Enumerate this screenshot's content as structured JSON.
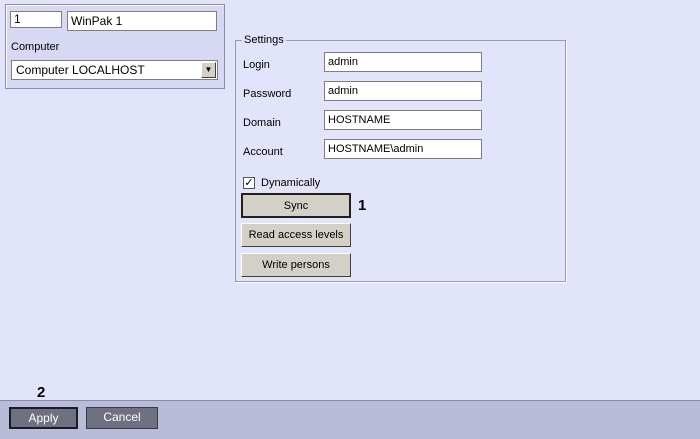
{
  "object": {
    "id": "1",
    "name": "WinPak 1"
  },
  "computer": {
    "label": "Computer",
    "selected": "Computer LOCALHOST"
  },
  "settings": {
    "legend": "Settings",
    "login_label": "Login",
    "login_value": "admin",
    "password_label": "Password",
    "password_value": "admin",
    "domain_label": "Domain",
    "domain_value": "HOSTNAME",
    "account_label": "Account",
    "account_value": "HOSTNAME\\admin",
    "dynamically_label": "Dynamically",
    "dynamically_checked": true
  },
  "buttons": {
    "sync": "Sync",
    "read_access": "Read access levels",
    "write_persons": "Write persons",
    "apply": "Apply",
    "cancel": "Cancel"
  },
  "annotations": {
    "sync_marker": "1",
    "apply_marker": "2"
  },
  "icons": {
    "dropdown": "chevron-down-icon",
    "check": "checkmark-icon"
  }
}
